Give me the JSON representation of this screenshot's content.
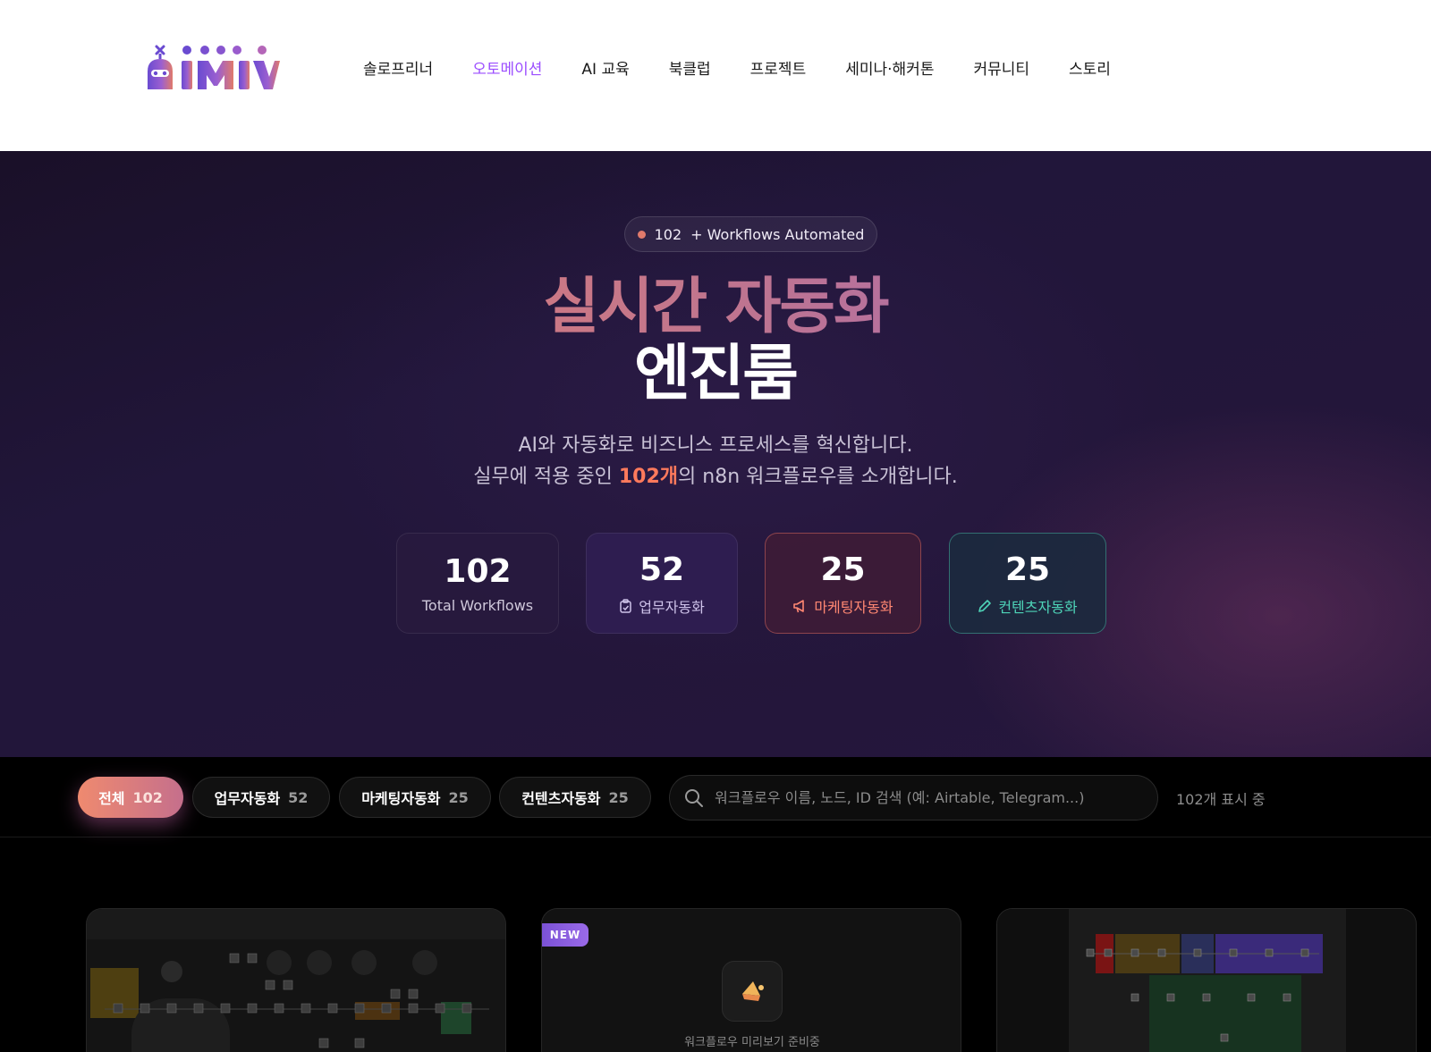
{
  "header": {
    "logo_alt": "aimiv",
    "nav": [
      {
        "label": "솔로프리너",
        "active": false
      },
      {
        "label": "오토메이션",
        "active": true
      },
      {
        "label": "AI 교육",
        "active": false
      },
      {
        "label": "북클럽",
        "active": false
      },
      {
        "label": "프로젝트",
        "active": false
      },
      {
        "label": "세미나·해커톤",
        "active": false
      },
      {
        "label": "커뮤니티",
        "active": false
      },
      {
        "label": "스토리",
        "active": false
      }
    ]
  },
  "hero": {
    "badge_count": "102",
    "badge_text": "+ Workflows Automated",
    "title_line1": "실시간 자동화",
    "title_line2": "엔진룸",
    "subtitle_line1": "AI와 자동화로 비즈니스 프로세스를 혁신합니다.",
    "subtitle_line2_pre": "실무에 적용 중인 ",
    "subtitle_line2_highlight": "102개",
    "subtitle_line2_post": "의 n8n 워크플로우를 소개합니다.",
    "stats": {
      "total": {
        "value": "102",
        "label": "Total Workflows"
      },
      "work": {
        "value": "52",
        "label": "업무자동화",
        "icon": "clipboard-icon"
      },
      "marketing": {
        "value": "25",
        "label": "마케팅자동화",
        "icon": "megaphone-icon"
      },
      "content": {
        "value": "25",
        "label": "컨텐츠자동화",
        "icon": "pencil-icon"
      }
    }
  },
  "filters": {
    "pills": [
      {
        "label": "전체",
        "count": "102",
        "active": true
      },
      {
        "label": "업무자동화",
        "count": "52",
        "active": false
      },
      {
        "label": "마케팅자동화",
        "count": "25",
        "active": false
      },
      {
        "label": "컨텐츠자동화",
        "count": "25",
        "active": false
      }
    ],
    "search_placeholder": "워크플로우 이름, 노드, ID 검색 (예: Airtable, Telegram...)",
    "result_count": "102개 표시 중"
  },
  "cards": {
    "card2": {
      "badge": "NEW",
      "preview_text": "워크플로우 미리보기 준비중",
      "icon": "megaphone-icon"
    }
  },
  "colors": {
    "accent_purple": "#9b4dff",
    "accent_coral": "#ff7a5c",
    "accent_teal": "#4ed4b8"
  }
}
